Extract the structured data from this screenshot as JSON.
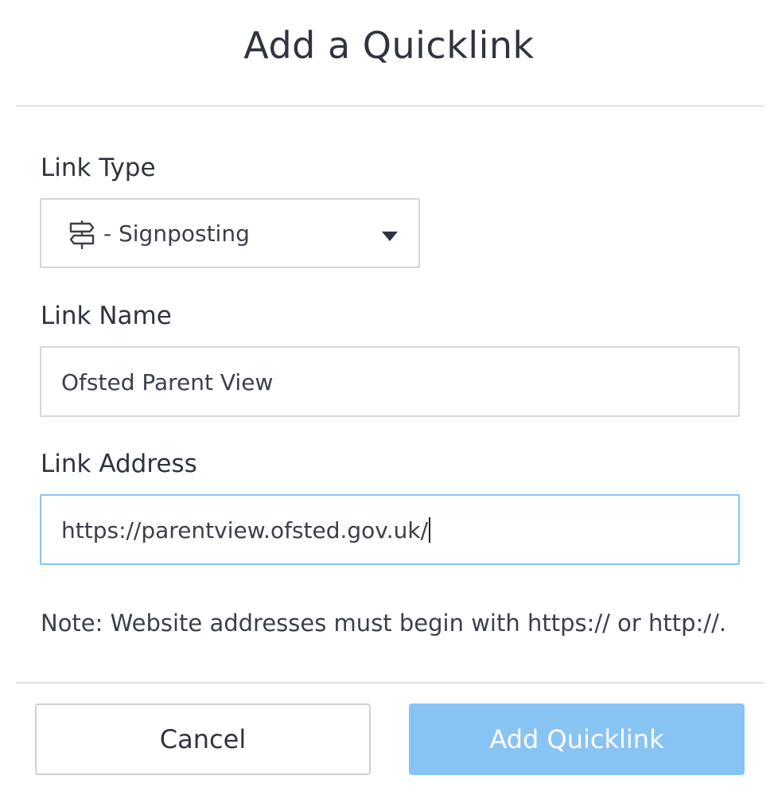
{
  "dialog": {
    "title": "Add a Quicklink"
  },
  "form": {
    "link_type": {
      "label": "Link Type",
      "selected": "- Signposting",
      "icon": "signpost-icon"
    },
    "link_name": {
      "label": "Link Name",
      "value": "Ofsted Parent View"
    },
    "link_address": {
      "label": "Link Address",
      "value": "https://parentview.ofsted.gov.uk/",
      "focused": true
    },
    "note": "Note: Website addresses must begin with https:// or http://."
  },
  "actions": {
    "cancel_label": "Cancel",
    "submit_label": "Add Quicklink"
  },
  "colors": {
    "accent_focus_border": "#8cc4ef",
    "submit_button": "#87c4f3",
    "text": "#2f3440"
  }
}
